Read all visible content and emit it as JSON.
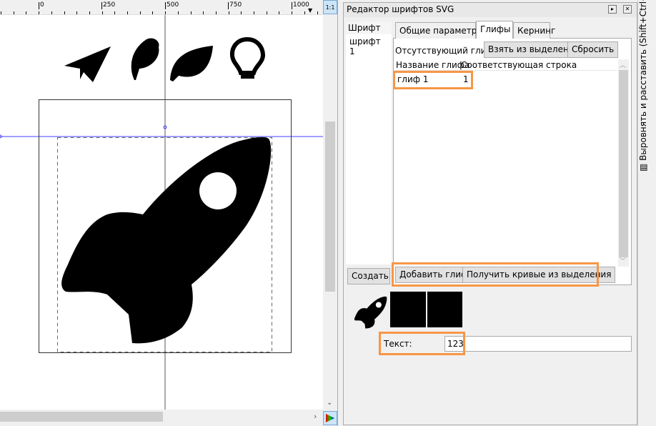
{
  "ruler": {
    "labels": [
      "0",
      "250",
      "500",
      "750",
      "1000"
    ]
  },
  "canvas": {
    "zoom_button": "1:1"
  },
  "panel": {
    "title": "Редактор шрифтов SVG",
    "fonts_header": "Шрифт",
    "fonts": [
      "шрифт 1"
    ],
    "create_button": "Создать",
    "tabs": [
      {
        "label": "Общие параметры",
        "active": false
      },
      {
        "label": "Глифы",
        "active": true
      },
      {
        "label": "Кернинг",
        "active": false
      }
    ],
    "missing_glyph_label": "Отсутствующий глиф:",
    "take_from_selection": "Взять из выделения",
    "reset": "Сбросить",
    "columns": [
      "Название глифа",
      "Соответствующая строка"
    ],
    "rows": [
      {
        "name": "глиф 1",
        "string": "1"
      }
    ],
    "add_glyph": "Добавить глиф",
    "get_curves": "Получить кривые из выделения",
    "text_label": "Текст:",
    "text_value": "123"
  },
  "side_tab": "Выровнять и расставить (Shift+Ctrl+A)",
  "highlight_color": "#f79646",
  "guide_color": "#3f3fff"
}
